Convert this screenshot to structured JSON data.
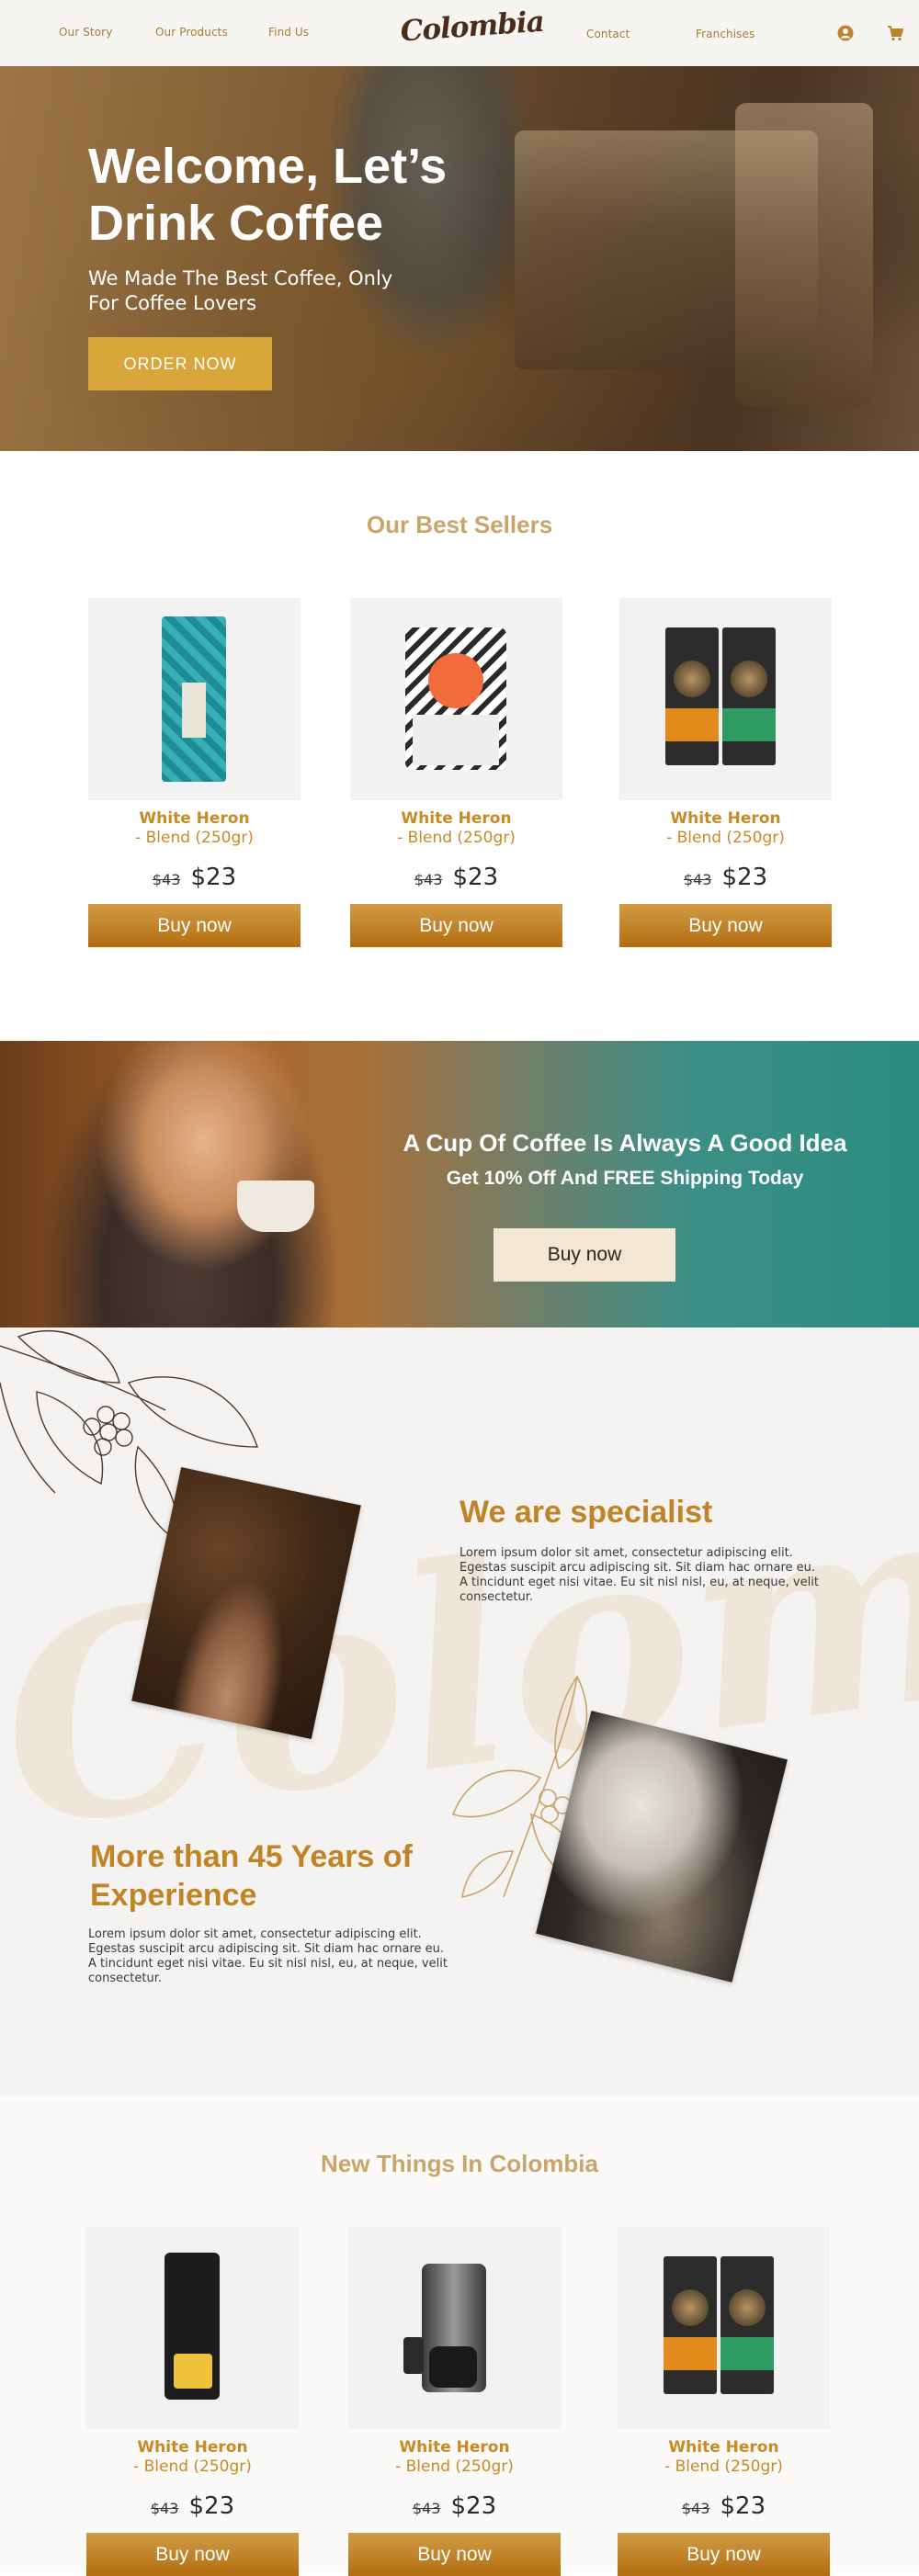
{
  "nav": {
    "links_left": [
      "Our Story",
      "Our Products",
      "Find Us"
    ],
    "brand": "Colombia",
    "links_right": [
      "Contact",
      "Franchises"
    ],
    "icons": [
      "account-icon",
      "cart-icon"
    ],
    "accent": "#a87b2f"
  },
  "hero": {
    "title": "Welcome, Let’s Drink Coffee",
    "subtitle": "We Made The Best Coffee, Only For Coffee Lovers",
    "cta": "ORDER NOW",
    "cta_color": "#d9a63c"
  },
  "best_sellers": {
    "title": "Our Best Sellers",
    "products": [
      {
        "name": "White Heron",
        "desc": "- Blend (250gr)",
        "old_price": "$43",
        "price": "$23",
        "buy": "Buy now"
      },
      {
        "name": "White Heron",
        "desc": "- Blend (250gr)",
        "old_price": "$43",
        "price": "$23",
        "buy": "Buy now"
      },
      {
        "name": "White Heron",
        "desc": "- Blend (250gr)",
        "old_price": "$43",
        "price": "$23",
        "buy": "Buy now"
      }
    ]
  },
  "promo": {
    "title": "A Cup Of Coffee Is Always A Good Idea",
    "subtitle": "Get 10% Off And FREE Shipping Today",
    "cta": "Buy now"
  },
  "specialist": {
    "title": "We are specialist",
    "body": "Lorem ipsum dolor sit amet, consectetur adipiscing elit. Egestas suscipit arcu adipiscing sit. Sit diam hac ornare eu. A tincidunt eget nisi vitae. Eu sit nisl nisl, eu, at neque, velit consectetur."
  },
  "experience": {
    "title": "More than 45 Years of Experience",
    "body": "Lorem ipsum dolor sit amet, consectetur adipiscing elit. Egestas suscipit arcu adipiscing sit. Sit diam hac ornare eu. A tincidunt eget nisi vitae. Eu sit nisl nisl, eu, at neque, velit consectetur."
  },
  "new_things": {
    "title": "New Things In Colombia",
    "products": [
      {
        "name": "White Heron",
        "desc": "- Blend (250gr)",
        "old_price": "$43",
        "price": "$23",
        "buy": "Buy now"
      },
      {
        "name": "White Heron",
        "desc": "- Blend (250gr)",
        "old_price": "$43",
        "price": "$23",
        "buy": "Buy now"
      },
      {
        "name": "White Heron",
        "desc": "- Blend (250gr)",
        "old_price": "$43",
        "price": "$23",
        "buy": "Buy now"
      }
    ]
  }
}
